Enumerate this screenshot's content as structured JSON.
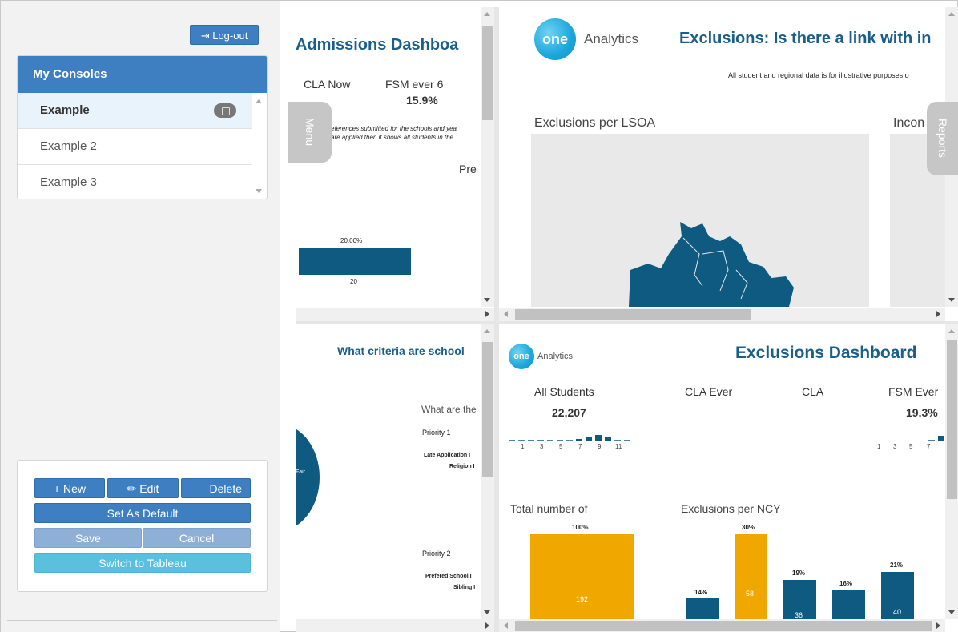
{
  "sidebar": {
    "logout_label": "Log-out",
    "consoles_title": "My Consoles",
    "items": [
      {
        "label": "Example"
      },
      {
        "label": "Example 2"
      },
      {
        "label": "Example 3"
      }
    ],
    "buttons": {
      "new": "+ New",
      "edit": "Edit",
      "delete": "Delete",
      "set_default": "Set As Default",
      "save": "Save",
      "cancel": "Cancel",
      "switch": "Switch to Tableau"
    }
  },
  "tabs": {
    "menu": "Menu",
    "reports": "Reports"
  },
  "pane_tl": {
    "title": "Admissions Dashboa",
    "kpi1_label": "CLA Now",
    "kpi2_label": "FSM ever 6",
    "kpi2_value": "15.9%",
    "note1": "eferences submitted for the schools and yea",
    "note2": "are applied then it shows all students in the",
    "pre_label": "Pre",
    "bar_pct": "20.00%",
    "bar_value": "20"
  },
  "pane_tr": {
    "logo_text": "one",
    "brand": "Analytics",
    "title": "Exclusions: Is there a link with in",
    "disclaimer": "All student and regional data is for illustrative purposes o",
    "map1_label": "Exclusions per LSOA",
    "map2_label": "Incon"
  },
  "pane_bl": {
    "title": "What criteria are school",
    "question": "What are the",
    "priority1": "Priority 1",
    "p1_items": [
      "Late Application I",
      "Religion I"
    ],
    "priority2": "Priority 2",
    "p2_items": [
      "Prefered School I",
      "Sibling I"
    ],
    "pie_label": "Fair"
  },
  "pane_br": {
    "logo_text": "one",
    "brand": "Analytics",
    "title": "Exclusions Dashboard",
    "kpis": [
      {
        "label": "All Students",
        "value": "22,207"
      },
      {
        "label": "CLA Ever",
        "value": ""
      },
      {
        "label": "CLA",
        "value": ""
      },
      {
        "label": "FSM Ever",
        "value": "19.3%"
      }
    ],
    "spark_ticks_left": [
      "1",
      "3",
      "5",
      "7",
      "9",
      "11"
    ],
    "spark_ticks_right": [
      "1",
      "3",
      "5",
      "7"
    ],
    "total_label": "Total number of",
    "ncy_label": "Exclusions per NCY",
    "total_bar": {
      "pct": "100%",
      "value": "192"
    },
    "ncy_bars": [
      {
        "pct": "14%",
        "value": ""
      },
      {
        "pct": "30%",
        "value": "58"
      },
      {
        "pct": "19%",
        "value": "36"
      },
      {
        "pct": "16%",
        "value": ""
      },
      {
        "pct": "21%",
        "value": "40"
      }
    ]
  },
  "colors": {
    "navy": "#0f5a80",
    "gold": "#f0a800",
    "accent": "#3d7fc1"
  }
}
